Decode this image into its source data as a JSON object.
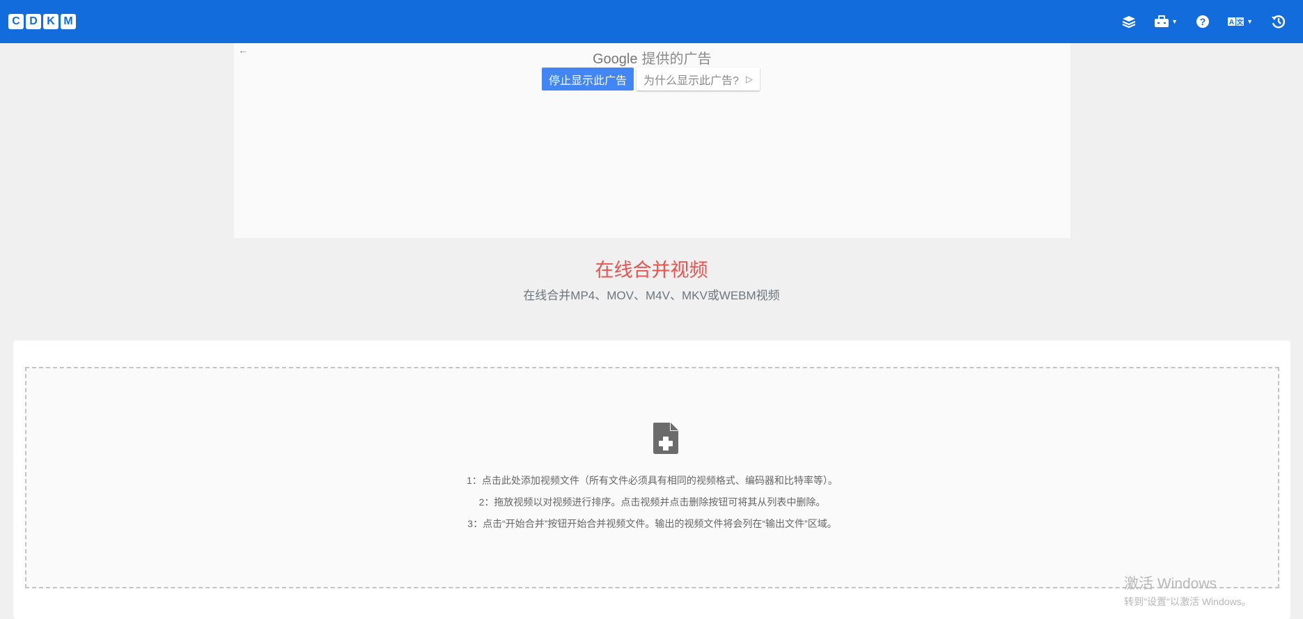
{
  "navbar": {
    "logo_letters": [
      "C",
      "D",
      "K",
      "M"
    ],
    "icons": [
      "layers-icon",
      "toolbox-icon",
      "help-icon",
      "language-icon",
      "history-icon"
    ],
    "brand_color": "#136cdc"
  },
  "ad": {
    "provider_brand": "Google",
    "provider_text": "提供的广告",
    "stop_label": "停止显示此广告",
    "why_label": "为什么显示此广告?",
    "back_icon": "←"
  },
  "page": {
    "title": "在线合并视频",
    "subtitle": "在线合并MP4、MOV、M4V、MKV或WEBM视频",
    "title_color": "#e9534f"
  },
  "dropzone": {
    "instructions": [
      "1：点击此处添加视频文件（所有文件必须具有相同的视频格式、编码器和比特率等）。",
      "2：拖放视频以对视频进行排序。点击视频并点击删除按钮可将其从列表中删除。",
      "3：点击“开始合并”按钮开始合并视频文件。输出的视频文件将会列在“输出文件”区域。"
    ]
  },
  "watermark": {
    "line1": "激活 Windows",
    "line2": "转到\"设置\"以激活 Windows。"
  }
}
